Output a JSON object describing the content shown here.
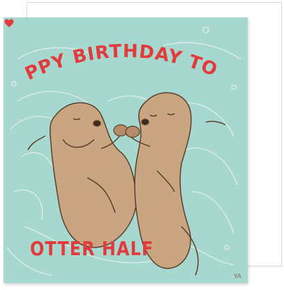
{
  "card": {
    "headline_line": "HAPPY BIRTHDAY TO MY",
    "closing_line": "OTTER HALF",
    "signature": "YA"
  },
  "icons": [
    "heart-icon",
    "otter-illustration-left",
    "otter-illustration-right"
  ],
  "colors": {
    "background": "#a7d8cf",
    "text": "#e23b3b",
    "otter_fur": "#c9a582",
    "otter_outline": "#5a3e2b",
    "swirl": "#f4f7f1",
    "envelope": "#ffffff"
  }
}
